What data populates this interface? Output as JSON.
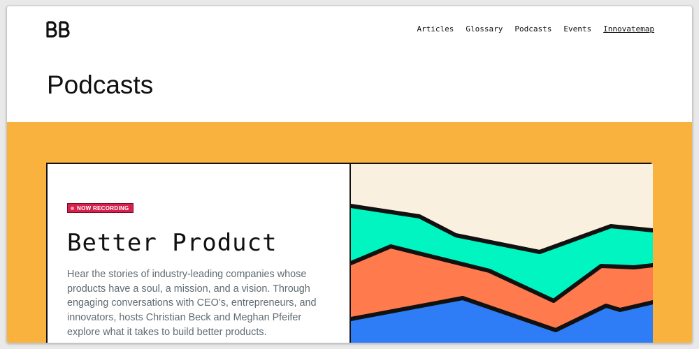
{
  "header": {
    "logo_text": "BB",
    "nav": [
      {
        "label": "Articles"
      },
      {
        "label": "Glossary"
      },
      {
        "label": "Podcasts"
      },
      {
        "label": "Events"
      },
      {
        "label": "Innovatemap"
      }
    ]
  },
  "page": {
    "title": "Podcasts",
    "band_color": "#f9b23d"
  },
  "feature": {
    "badge": "NOW RECORDING",
    "badge_color": "#d6214c",
    "title": "Better Product",
    "description": "Hear the stories of industry-leading companies whose products have a soul, a mission, and a vision. Through engaging conversations with CEO’s, entrepreneurs, and innovators, hosts Christian Beck and Meghan Pfeifer explore what it takes to build better products.",
    "artwork_colors": {
      "background": "#faf0df",
      "teal": "#00f5c0",
      "orange": "#ff7b4d",
      "blue": "#2f7df6"
    }
  }
}
